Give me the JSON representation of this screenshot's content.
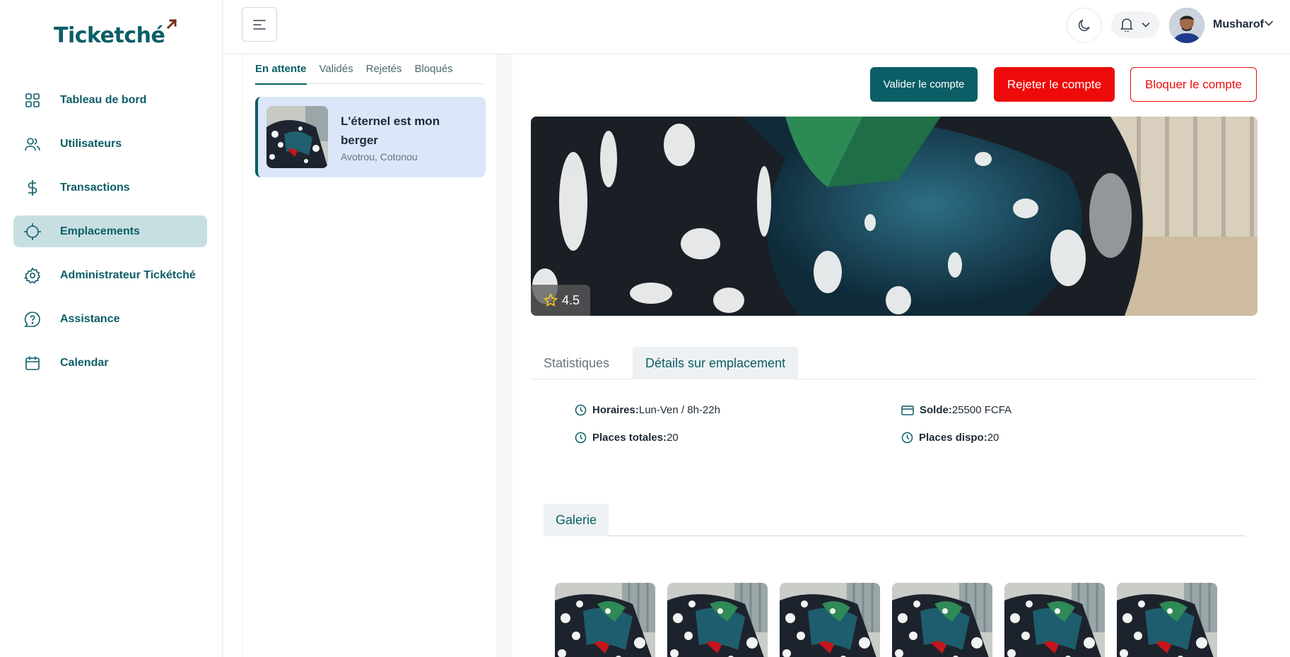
{
  "brand": {
    "name": "Ticketché"
  },
  "sidebar": {
    "items": [
      {
        "label": "Tableau de bord",
        "icon": "grid-icon"
      },
      {
        "label": "Utilisateurs",
        "icon": "users-icon"
      },
      {
        "label": "Transactions",
        "icon": "dollar-icon"
      },
      {
        "label": "Emplacements",
        "icon": "crosshair-icon",
        "active": true
      },
      {
        "label": "Administrateur Tickétché",
        "icon": "gear-icon"
      },
      {
        "label": "Assistance",
        "icon": "help-chat-icon"
      },
      {
        "label": "Calendar",
        "icon": "calendar-icon"
      }
    ]
  },
  "header": {
    "user_name": "Musharof"
  },
  "list": {
    "tabs": [
      "En attente",
      "Validés",
      "Rejetés",
      "Bloqués"
    ],
    "active_tab": "En attente",
    "card": {
      "title": "L'éternel est mon berger",
      "subtitle": "Avotrou, Cotonou"
    }
  },
  "detail": {
    "actions": {
      "validate": "Valider le compte",
      "reject": "Rejeter le compte",
      "block": "Bloquer le compte"
    },
    "rating": "4.5",
    "tabs": [
      "Statistiques",
      "Détails sur emplacement"
    ],
    "active_tab": "Détails sur emplacement",
    "info": {
      "horaires_label": "Horaires:",
      "horaires_value": "Lun-Ven / 8h-22h",
      "solde_label": "Solde:",
      "solde_value": "25500 FCFA",
      "places_totales_label": "Places totales:",
      "places_totales_value": "20",
      "places_dispo_label": "Places dispo:",
      "places_dispo_value": "20"
    },
    "gallery_tab": "Galerie",
    "gallery_count": 6
  },
  "colors": {
    "primary": "#0b5e66",
    "danger": "#ee0a0a",
    "active_nav_bg": "#c8dfe2",
    "card_bg": "#dbe6f8"
  }
}
